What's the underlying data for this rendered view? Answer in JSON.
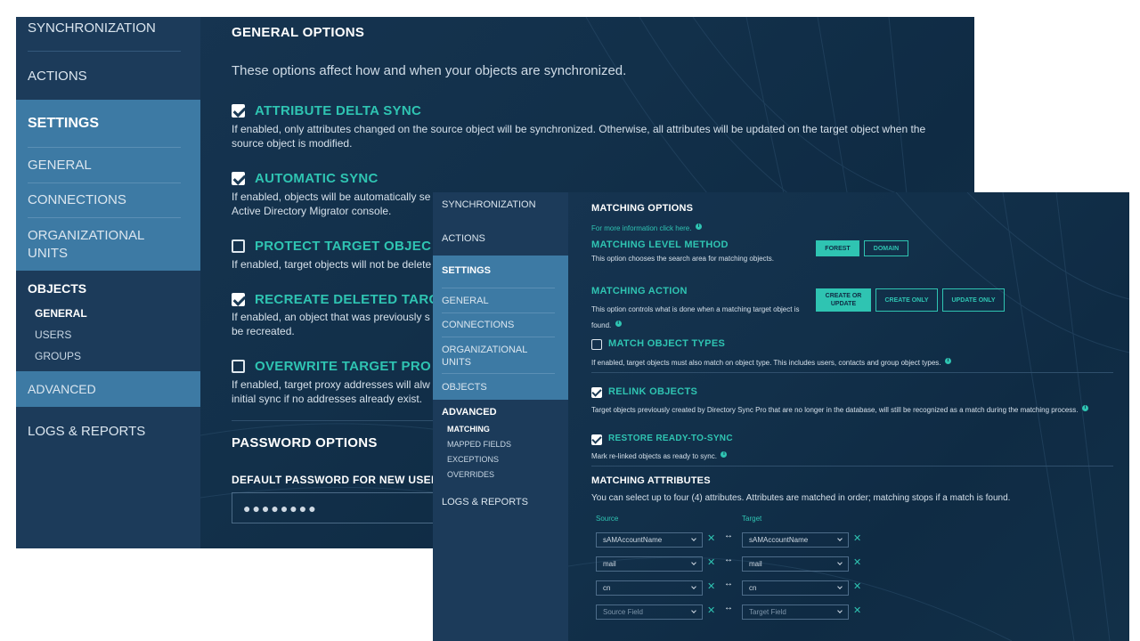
{
  "back": {
    "sidebar": {
      "synchronization": "SYNCHRONIZATION",
      "actions": "ACTIONS",
      "settings": "SETTINGS",
      "general": "GENERAL",
      "connections": "CONNECTIONS",
      "org_units": "ORGANIZATIONAL UNITS",
      "objects": "OBJECTS",
      "objects_sub": [
        "GENERAL",
        "USERS",
        "GROUPS"
      ],
      "advanced": "ADVANCED",
      "logs": "LOGS & REPORTS"
    },
    "general_options_title": "GENERAL OPTIONS",
    "intro": "These options affect how and when your objects are synchronized.",
    "options": [
      {
        "title": "ATTRIBUTE DELTA SYNC",
        "checked": true,
        "desc": "If enabled, only attributes changed on the source object will be synchronized. Otherwise, all attributes will be updated on the target object when the source object is modified."
      },
      {
        "title": "AUTOMATIC SYNC",
        "checked": true,
        "desc": "If enabled, objects will be automatically se",
        "desc2": "Active Directory Migrator console."
      },
      {
        "title": "PROTECT TARGET OBJEC",
        "checked": false,
        "desc": "If enabled, target objects will not be delete"
      },
      {
        "title": "RECREATE DELETED TARG",
        "checked": true,
        "desc": "If enabled, an object that was previously s",
        "desc2": "be recreated."
      },
      {
        "title": "OVERWRITE TARGET PRO",
        "checked": false,
        "desc": "If enabled, target proxy addresses will alw",
        "desc2": "initial sync if no addresses already exist."
      }
    ],
    "password_options_title": "PASSWORD OPTIONS",
    "default_password_label": "DEFAULT PASSWORD FOR NEW USERS",
    "password_value": "●●●●●●●●"
  },
  "front": {
    "sidebar": {
      "synchronization": "SYNCHRONIZATION",
      "actions": "ACTIONS",
      "settings": "SETTINGS",
      "general": "GENERAL",
      "connections": "CONNECTIONS",
      "org_units": "ORGANIZATIONAL UNITS",
      "objects": "OBJECTS",
      "advanced": "ADVANCED",
      "advanced_sub": [
        "MATCHING",
        "MAPPED FIELDS",
        "EXCEPTIONS",
        "OVERRIDES"
      ],
      "logs": "LOGS & REPORTS"
    },
    "matching_options_title": "MATCHING OPTIONS",
    "more_info_link": "For more information click here.",
    "level_method": {
      "title": "MATCHING LEVEL METHOD",
      "desc": "This option chooses the search area for matching objects.",
      "buttons": [
        "FOREST",
        "DOMAIN"
      ]
    },
    "action": {
      "title": "MATCHING ACTION",
      "desc": "This option controls what is done when a matching target object is found.",
      "buttons": [
        "CREATE OR UPDATE",
        "CREATE ONLY",
        "UPDATE ONLY"
      ]
    },
    "match_object_types": {
      "title": "MATCH OBJECT TYPES",
      "checked": false,
      "desc": "If enabled, target objects must also match on object type. This includes users, contacts and group object types."
    },
    "relink_objects": {
      "title": "RELINK OBJECTS",
      "checked": true,
      "desc": "Target objects previously created by Directory Sync Pro that are no longer in the database, will still be recognized as a match during the matching process."
    },
    "restore_ready": {
      "title": "RESTORE READY-TO-SYNC",
      "checked": true,
      "desc": "Mark re-linked objects as ready to sync."
    },
    "matching_attributes": {
      "title": "MATCHING ATTRIBUTES",
      "desc": "You can select up to four (4) attributes. Attributes are matched in order; matching stops if a match is found.",
      "source_label": "Source",
      "target_label": "Target",
      "rows": [
        {
          "source": "sAMAccountName",
          "target": "sAMAccountName"
        },
        {
          "source": "mail",
          "target": "mail"
        },
        {
          "source": "cn",
          "target": "cn"
        },
        {
          "source": "Source Field",
          "target": "Target Field"
        }
      ]
    }
  },
  "colors": {
    "accent": "#2fc4b2",
    "sidebar": "#1c3b5a",
    "sidebar_active": "#3d7aa4",
    "background": "#12304a"
  }
}
